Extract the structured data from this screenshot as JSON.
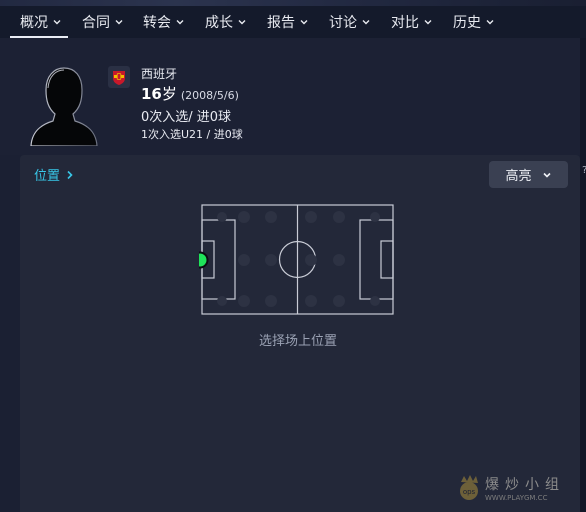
{
  "nav": {
    "tabs": [
      {
        "label": "概况",
        "active": true
      },
      {
        "label": "合同"
      },
      {
        "label": "转会"
      },
      {
        "label": "成长"
      },
      {
        "label": "报告"
      },
      {
        "label": "讨论"
      },
      {
        "label": "对比"
      },
      {
        "label": "历史"
      }
    ]
  },
  "player": {
    "nationality": "西班牙",
    "age": "16",
    "age_unit": "岁",
    "dob": "(2008/5/6)",
    "senior_caps": "0次入选/ 进0球",
    "u21_caps": "1次入选U21 / 进0球"
  },
  "position_panel": {
    "link_label": "位置",
    "highlight_label": "高亮",
    "hint": "选择场上位置",
    "selected_position": "GK",
    "marker_color": "#1fe35a"
  },
  "watermark": {
    "text": "爆炒小组",
    "url": "WWW.PLAYGM.CC"
  },
  "colors": {
    "accent": "#38c7e8",
    "background": "#1b2033",
    "card": "#232839"
  },
  "icons": [
    "chevron-down-icon",
    "chevron-right-icon",
    "player-silhouette-icon",
    "spain-flag-icon"
  ]
}
